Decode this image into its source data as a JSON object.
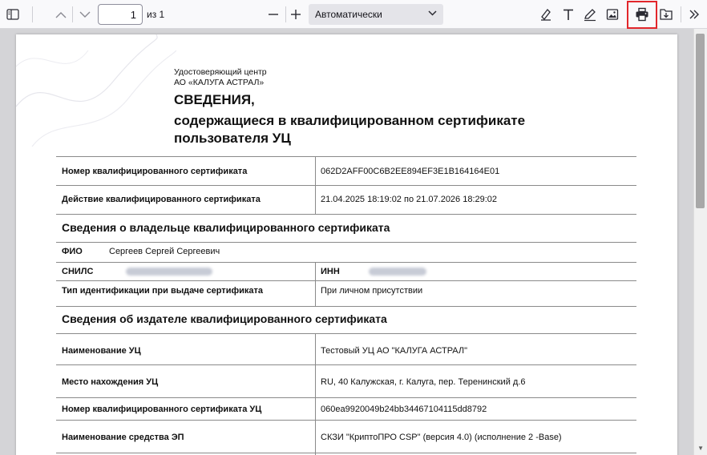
{
  "toolbar": {
    "page_number": "1",
    "page_of": "из 1",
    "zoom_value": "Автоматически",
    "icons": [
      "sidebar-toggle-icon",
      "chevron-up-icon",
      "chevron-down-icon",
      "minus-icon",
      "plus-icon",
      "chevron-down-icon",
      "highlight-icon",
      "text-icon",
      "draw-icon",
      "image-icon",
      "print-icon",
      "save-icon",
      "tools-chevron-icon"
    ],
    "highlight_color": "#e2262b"
  },
  "document": {
    "issuer_line1": "Удостоверяющий центр",
    "issuer_line2": "АО «КАЛУГА АСТРАЛ»",
    "title": "СВЕДЕНИЯ,",
    "subtitle_line1": "содержащиеся в квалифицированном сертификате",
    "subtitle_line2": "пользователя УЦ",
    "rows": {
      "cert_number_label": "Номер квалифицированного сертификата",
      "cert_number_value": "062D2AFF00C6B2EE894EF3E1B164164E01",
      "validity_label": "Действие квалифицированного сертификата",
      "validity_value": "21.04.2025 18:19:02 по 21.07.2026 18:29:02"
    },
    "owner": {
      "section_title": "Сведения о владельце квалифицированного сертификата",
      "fio_label": "ФИО",
      "fio_value": "Сергеев Сергей Сергеевич",
      "snils_label": "СНИЛС",
      "inn_label": "ИНН",
      "id_type_label": "Тип идентификации при выдаче сертификата",
      "id_type_value": "При личном присутствии"
    },
    "issuer_info": {
      "section_title": "Сведения об издателе квалифицированного сертификата",
      "ca_name_label": "Наименование УЦ",
      "ca_name_value": "Тестовый УЦ АО \"КАЛУГА АСТРАЛ\"",
      "ca_location_label": "Место нахождения УЦ",
      "ca_location_value": "RU, 40 Калужская, г. Калуга, пер. Теренинский д.6",
      "ca_cert_number_label": "Номер квалифицированного сертификата УЦ",
      "ca_cert_number_value": "060ea9920049b24bb34467104115dd8792",
      "ep_tool_label": "Наименование средства ЭП",
      "ep_tool_value": "СКЗИ \"КриптоПРО CSP\" (версия 4.0) (исполнение 2 -Base)"
    }
  }
}
